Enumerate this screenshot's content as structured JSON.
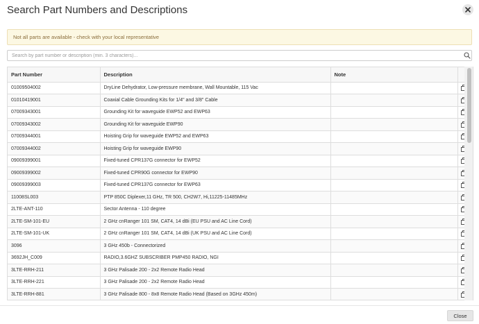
{
  "dialog": {
    "title": "Search Part Numbers and Descriptions",
    "close_icon": "close-icon"
  },
  "warning": {
    "text": "Not all parts are available - check with your local representative"
  },
  "search": {
    "placeholder": "Search by part number or description (min. 3 characters)...",
    "value": "",
    "icon": "search-icon"
  },
  "table": {
    "headers": [
      "Part Number",
      "Description",
      "Note",
      ""
    ],
    "row_icon": "copy-icon",
    "rows": [
      {
        "part": "01009504002",
        "desc": "DryLine Dehydrator, Low-pressure membrane, Wall Mountable, 115 Vac",
        "note": ""
      },
      {
        "part": "01010419001",
        "desc": "Coaxial Cable Grounding Kits for 1/4\" and 3/8\" Cable",
        "note": ""
      },
      {
        "part": "07009343001",
        "desc": "Grounding Kit for waveguide EWP52 and EWP63",
        "note": ""
      },
      {
        "part": "07009343002",
        "desc": "Grounding Kit for waveguide EWP90",
        "note": ""
      },
      {
        "part": "07009344001",
        "desc": "Hoisting Grip for waveguide EWP52 and EWP63",
        "note": ""
      },
      {
        "part": "07009344002",
        "desc": "Hoisting Grip for waveguide EWP90",
        "note": ""
      },
      {
        "part": "09009399001",
        "desc": "Fixed-tuned CPR137G connector for EWP52",
        "note": ""
      },
      {
        "part": "09009399002",
        "desc": "Fixed-tuned CPR90G connector for EWP90",
        "note": ""
      },
      {
        "part": "09009399003",
        "desc": "Fixed-tuned CPR137G connector for EWP63",
        "note": ""
      },
      {
        "part": "11008SL003",
        "desc": "PTP 850C Diplexer,11 GHz, TR 500, CH2W7, Hi,11225-11485MHz",
        "note": ""
      },
      {
        "part": "2LTE-ANT-110",
        "desc": "Sector Antenna - 110 degree",
        "note": ""
      },
      {
        "part": "2LTE-SM-101-EU",
        "desc": "2 GHz cnRanger 101 SM, CAT4, 14 dBi (EU PSU and AC Line Cord)",
        "note": ""
      },
      {
        "part": "2LTE-SM-101-UK",
        "desc": "2 GHz cnRanger 101 SM, CAT4, 14 dBi (UK PSU and AC Line Cord)",
        "note": ""
      },
      {
        "part": "3096",
        "desc": "3 GHz 450b - Connectorized",
        "note": ""
      },
      {
        "part": "3692JH_C009",
        "desc": "RADIO,3.6GHZ SUBSCRIBER PMP450 RADIO, NGI",
        "note": ""
      },
      {
        "part": "3LTE-RRH-211",
        "desc": "3 GHz Palisade 200 - 2x2 Remote Radio Head",
        "note": ""
      },
      {
        "part": "3LTE-RRH-221",
        "desc": "3 GHz Palisade 200 - 2x2 Remote Radio Head",
        "note": ""
      },
      {
        "part": "3LTE-RRH-881",
        "desc": "3 GHz Palisade 800 - 8x8 Remote Radio Head (Based on 3GHz 450m)",
        "note": ""
      }
    ]
  },
  "footer": {
    "close_label": "Close"
  }
}
